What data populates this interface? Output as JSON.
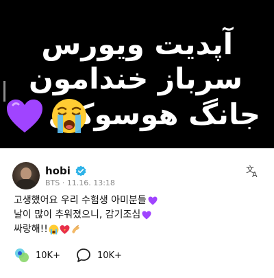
{
  "banner": {
    "line1": "آپدیت ویورس",
    "line2": "سرباز خندامون",
    "line3": "جانگ هوسوکی"
  },
  "post": {
    "username": "hobi",
    "group": "BTS",
    "separator": "·",
    "date": "11.16. 13:18",
    "lines": [
      "고생했어요 우리 수험생 아미분들",
      "날이 많이 추워졌으니, 감기조심",
      "싸랑해!!"
    ],
    "likes": "10K+",
    "comments": "10K+"
  },
  "colors": {
    "purple_heart": "#a044ff",
    "verified_badge": "#2fb3e8"
  },
  "icons": [
    "purple-heart-icon",
    "crying-face-icon",
    "verified-icon",
    "translate-icon",
    "like-icon",
    "comment-icon"
  ]
}
